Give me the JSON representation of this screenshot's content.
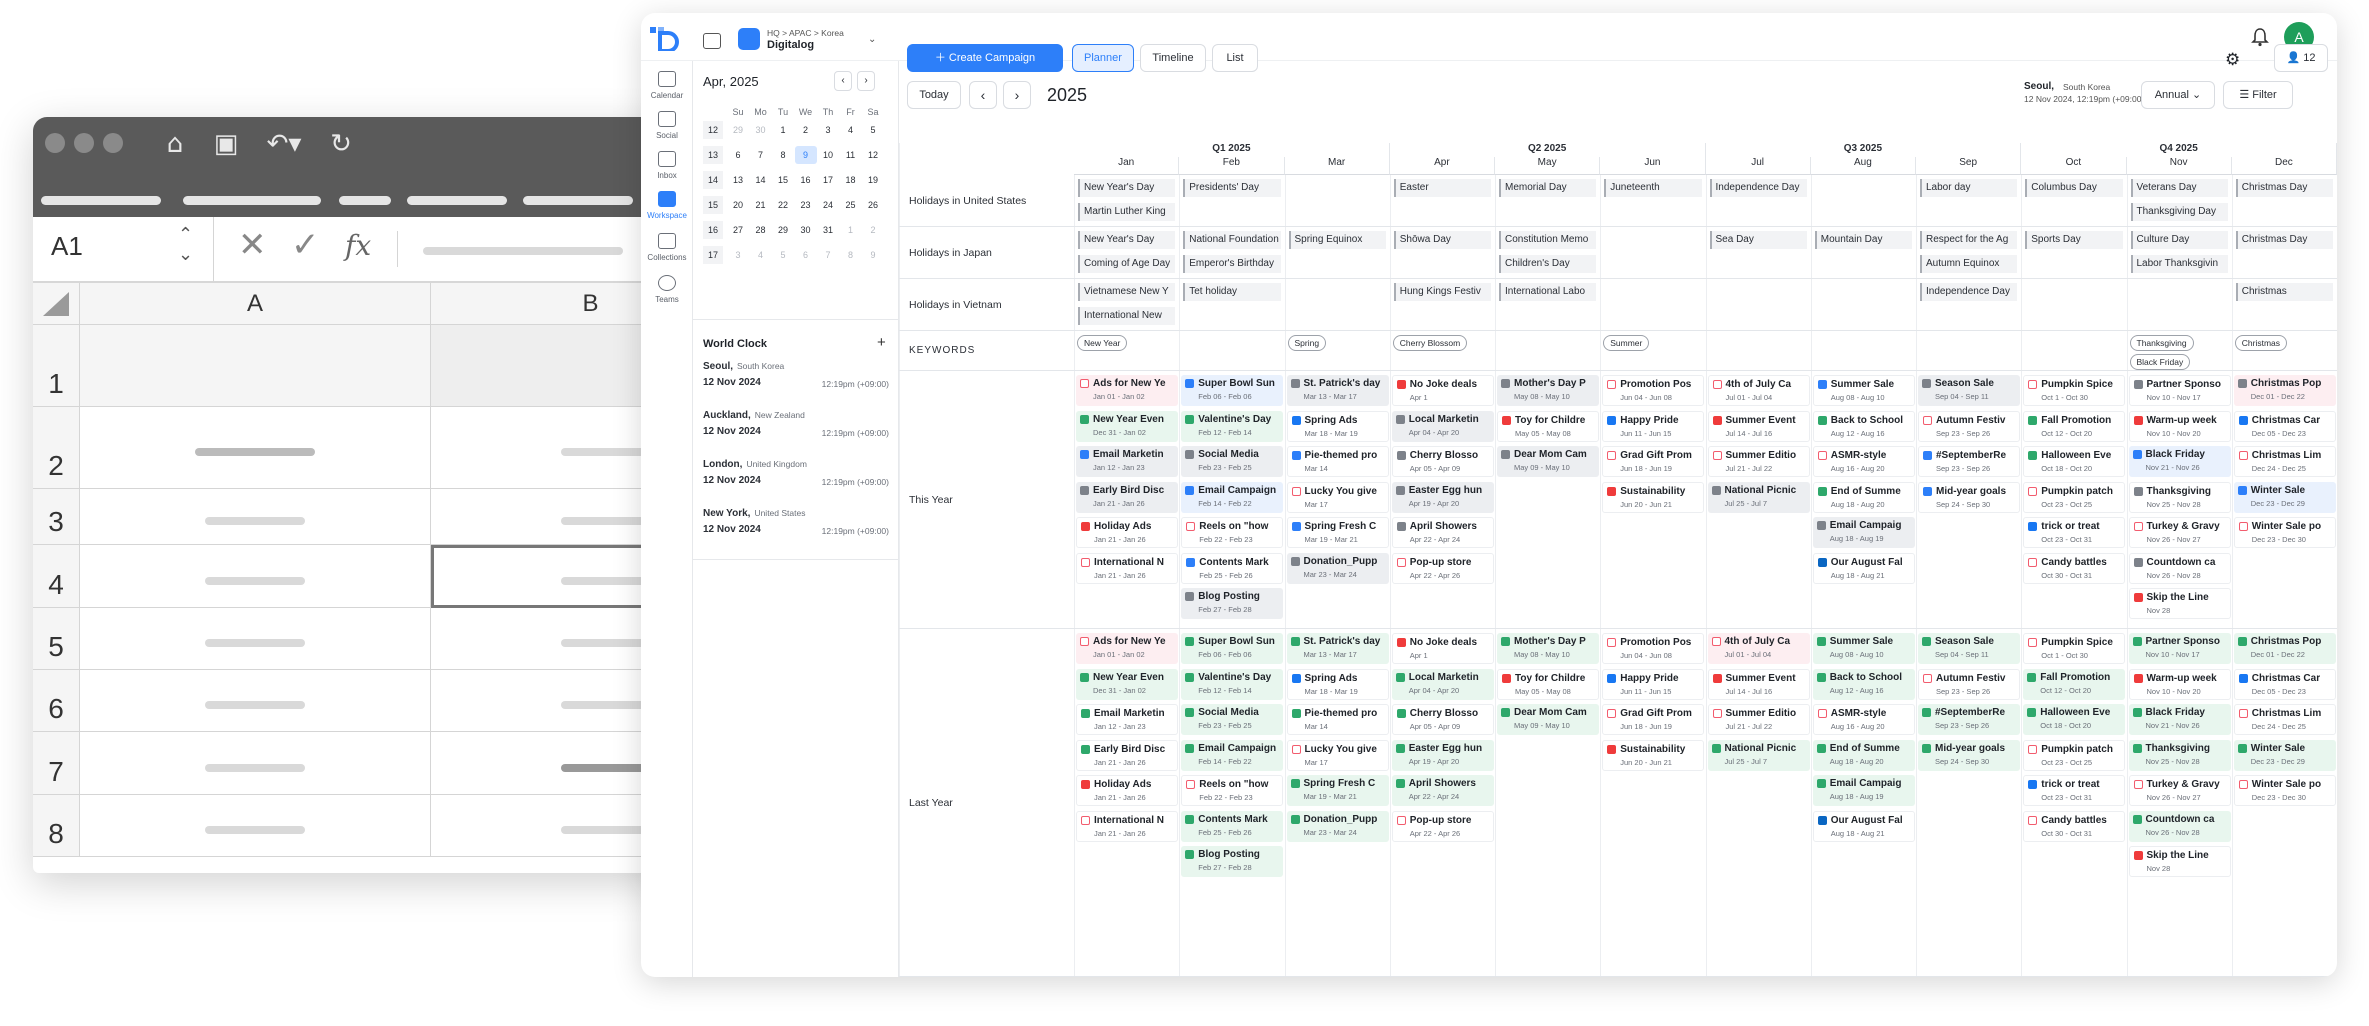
{
  "sheet": {
    "cell_ref": "A1",
    "fx": "fx",
    "col_a": "A",
    "col_b": "B",
    "rows": [
      "1",
      "2",
      "3",
      "4",
      "5",
      "6",
      "7",
      "8"
    ]
  },
  "app": {
    "breadcrumb": "HQ > APAC > Korea",
    "workspace": "Digitalog",
    "create": "Create Campaign",
    "views": [
      "Planner",
      "Timeline",
      "List"
    ],
    "member_count": "12",
    "avatar": "A",
    "nav": [
      "Calendar",
      "Social",
      "Inbox",
      "Workspace",
      "Collections",
      "Teams"
    ],
    "today": "Today",
    "year": "2025",
    "location": "Seoul,",
    "location_country": "South Korea",
    "location_time": "12 Nov 2024, 12:19pm (+09:00)",
    "range": "Annual",
    "filter": "Filter"
  },
  "minical": {
    "title": "Apr, 2025",
    "weekdays": [
      "Su",
      "Mo",
      "Tu",
      "We",
      "Th",
      "Fr",
      "Sa"
    ],
    "weeks": [
      {
        "wk": "12",
        "days": [
          "29",
          "30",
          "1",
          "2",
          "3",
          "4",
          "5"
        ]
      },
      {
        "wk": "13",
        "days": [
          "6",
          "7",
          "8",
          "9",
          "10",
          "11",
          "12"
        ]
      },
      {
        "wk": "14",
        "days": [
          "13",
          "14",
          "15",
          "16",
          "17",
          "18",
          "19"
        ]
      },
      {
        "wk": "15",
        "days": [
          "20",
          "21",
          "22",
          "23",
          "24",
          "25",
          "26"
        ]
      },
      {
        "wk": "16",
        "days": [
          "27",
          "28",
          "29",
          "30",
          "31",
          "1",
          "2"
        ]
      },
      {
        "wk": "17",
        "days": [
          "3",
          "4",
          "5",
          "6",
          "7",
          "8",
          "9"
        ]
      }
    ]
  },
  "world_clock": {
    "title": "World Clock",
    "add": "+",
    "items": [
      {
        "city": "Seoul,",
        "country": "South Korea",
        "date": "12 Nov 2024",
        "time": "12:19pm (+09:00)"
      },
      {
        "city": "Auckland,",
        "country": "New Zealand",
        "date": "12 Nov 2024",
        "time": "12:19pm (+09:00)"
      },
      {
        "city": "London,",
        "country": "United Kingdom",
        "date": "12 Nov 2024",
        "time": "12:19pm (+09:00)"
      },
      {
        "city": "New York,",
        "country": "United States",
        "date": "12 Nov 2024",
        "time": "12:19pm (+09:00)"
      }
    ]
  },
  "timeline": {
    "quarters": [
      "Q1  2025",
      "Q2  2025",
      "Q3  2025",
      "Q4  2025"
    ],
    "months": [
      "Jan",
      "Feb",
      "Mar",
      "Apr",
      "May",
      "Jun",
      "Jul",
      "Aug",
      "Sep",
      "Oct",
      "Nov",
      "Dec"
    ],
    "rows": [
      "Holidays in United States",
      "Holidays in Japan",
      "Holidays in Vietnam",
      "KEYWORDS",
      "This Year",
      "Last Year"
    ],
    "holidays_us": [
      [
        "New Year's Day",
        "Martin Luther King"
      ],
      [
        "Presidents' Day"
      ],
      [],
      [
        "Easter"
      ],
      [
        "Memorial Day"
      ],
      [
        "Juneteenth"
      ],
      [
        "Independence Day"
      ],
      [],
      [
        "Labor day"
      ],
      [
        "Columbus Day"
      ],
      [
        "Veterans Day",
        "Thanksgiving Day"
      ],
      [
        "Christmas Day"
      ]
    ],
    "holidays_jp": [
      [
        "New Year's Day",
        "Coming of Age Day"
      ],
      [
        "National Foundation",
        "Emperor's Birthday"
      ],
      [
        "Spring Equinox"
      ],
      [
        "Shōwa Day"
      ],
      [
        "Constitution Memo",
        "Children's Day"
      ],
      [],
      [
        "Sea Day"
      ],
      [
        "Mountain Day"
      ],
      [
        "Respect for the Ag",
        "Autumn Equinox"
      ],
      [
        "Sports Day"
      ],
      [
        "Culture Day",
        "Labor Thanksgivin"
      ],
      [
        "Christmas Day"
      ]
    ],
    "holidays_vn": [
      [
        "Vietnamese New Y",
        "International New"
      ],
      [
        "Tet holiday"
      ],
      [],
      [
        "Hung Kings Festiv"
      ],
      [
        "International Labo"
      ],
      [],
      [],
      [],
      [
        "Independence Day"
      ],
      [],
      [],
      [
        "Christmas"
      ]
    ],
    "keywords": [
      [
        "New Year"
      ],
      [],
      [
        "Spring"
      ],
      [
        "Cherry Blossom"
      ],
      [],
      [
        "Summer"
      ],
      [],
      [],
      [],
      [],
      [
        "Thanksgiving",
        "Black Friday"
      ],
      [
        "Christmas"
      ]
    ],
    "this_year": [
      [
        [
          "Ads for New Ye",
          "Jan 01 - Jan 02",
          "pink",
          "ig"
        ],
        [
          "New Year Even",
          "Dec 31 - Jan 02",
          "green",
          "green"
        ],
        [
          "Email Marketin",
          "Jan 12 - Jan 23",
          "gray",
          "blue"
        ],
        [
          "Early Bird Disc",
          "Jan 21 - Jan 26",
          "gray",
          "gray"
        ],
        [
          "Holiday Ads",
          "Jan 21 - Jan 26",
          "white",
          "red"
        ],
        [
          "International N",
          "Jan 21 - Jan 26",
          "white",
          "ig"
        ]
      ],
      [
        [
          "Super Bowl Sun",
          "Feb 06 - Feb 06",
          "blue",
          "blue"
        ],
        [
          "Valentine's Day",
          "Feb 12 - Feb 14",
          "green",
          "green"
        ],
        [
          "Social Media",
          "Feb 23 - Feb 25",
          "gray",
          "gray"
        ],
        [
          "Email Campaign",
          "Feb 14 - Feb 22",
          "blue",
          "blue"
        ],
        [
          "Reels on \"how",
          "Feb 22 - Feb 23",
          "white",
          "ig"
        ],
        [
          "Contents Mark",
          "Feb 25 - Feb 26",
          "white",
          "blue"
        ],
        [
          "Blog Posting",
          "Feb 27 - Feb 28",
          "gray",
          "gray"
        ]
      ],
      [
        [
          "St. Patrick's day",
          "Mar 13 - Mar 17",
          "gray",
          "gray"
        ],
        [
          "Spring Ads",
          "Mar 18 - Mar 19",
          "white",
          "fb"
        ],
        [
          "Pie-themed pro",
          "Mar 14",
          "white",
          "blue"
        ],
        [
          "Lucky You give",
          "Mar 17",
          "white",
          "ig"
        ],
        [
          "Spring Fresh C",
          "Mar 19 - Mar 21",
          "white",
          "blue"
        ],
        [
          "Donation_Pupp",
          "Mar 23 - Mar 24",
          "gray",
          "gray"
        ]
      ],
      [
        [
          "No Joke deals",
          "Apr 1",
          "white",
          "red"
        ],
        [
          "Local Marketin",
          "Apr 04 - Apr 20",
          "gray",
          "gray"
        ],
        [
          "Cherry Blosso",
          "Apr 05 - Apr 09",
          "white",
          "gray"
        ],
        [
          "Easter Egg hun",
          "Apr 19 - Apr 20",
          "gray",
          "gray"
        ],
        [
          "April Showers",
          "Apr 22 - Apr 24",
          "white",
          "gray"
        ],
        [
          "Pop-up store",
          "Apr 22 - Apr 26",
          "white",
          "ig"
        ]
      ],
      [
        [
          "Mother's Day P",
          "May 08 - May 10",
          "gray",
          "gray"
        ],
        [
          "Toy for Childre",
          "May 05 - May 08",
          "white",
          "red"
        ],
        [
          "Dear Mom Cam",
          "May 09 - May 10",
          "gray",
          "gray"
        ]
      ],
      [
        [
          "Promotion Pos",
          "Jun 04 - Jun 08",
          "white",
          "ig"
        ],
        [
          "Happy Pride",
          "Jun 11 - Jun 15",
          "white",
          "fb"
        ],
        [
          "Grad Gift Prom",
          "Jun 18 - Jun 19",
          "white",
          "ig"
        ],
        [
          "Sustainability",
          "Jun 20 - Jun 21",
          "white",
          "red"
        ]
      ],
      [
        [
          "4th of July Ca",
          "Jul 01 - Jul 04",
          "white",
          "ig"
        ],
        [
          "Summer Event",
          "Jul 14 - Jul 16",
          "white",
          "red"
        ],
        [
          "Summer Editio",
          "Jul 21 - Jul 22",
          "white",
          "ig"
        ],
        [
          "National Picnic",
          "Jul 25 - Jul 7",
          "gray",
          "gray"
        ]
      ],
      [
        [
          "Summer Sale",
          "Aug 08 - Aug 10",
          "white",
          "blue"
        ],
        [
          "Back to School",
          "Aug 12 - Aug 16",
          "white",
          "green"
        ],
        [
          "ASMR-style",
          "Aug 16 - Aug 20",
          "white",
          "ig"
        ],
        [
          "End of Summe",
          "Aug 18 - Aug 20",
          "white",
          "green"
        ],
        [
          "Email Campaig",
          "Aug 18 - Aug 19",
          "gray",
          "gray"
        ],
        [
          "Our August Fal",
          "Aug 18 - Aug 21",
          "white",
          "li"
        ]
      ],
      [
        [
          "Season Sale",
          "Sep 04 - Sep 11",
          "gray",
          "gray"
        ],
        [
          "Autumn Festiv",
          "Sep 23 - Sep 26",
          "white",
          "ig"
        ],
        [
          "#SeptemberRe",
          "Sep 23 - Sep 26",
          "white",
          "blue"
        ],
        [
          "Mid-year goals",
          "Sep 24 - Sep 30",
          "white",
          "blue"
        ]
      ],
      [
        [
          "Pumpkin Spice",
          "Oct 1 - Oct 30",
          "white",
          "ig"
        ],
        [
          "Fall Promotion",
          "Oct 12 - Oct 20",
          "white",
          "green"
        ],
        [
          "Halloween Eve",
          "Oct 18 - Oct 20",
          "white",
          "green"
        ],
        [
          "Pumpkin patch",
          "Oct 23 - Oct 25",
          "white",
          "ig"
        ],
        [
          "trick or treat",
          "Oct 23 - Oct 31",
          "white",
          "fb"
        ],
        [
          "Candy battles",
          "Oct 30 - Oct 31",
          "white",
          "ig"
        ]
      ],
      [
        [
          "Partner Sponso",
          "Nov 10 - Nov 17",
          "white",
          "gray"
        ],
        [
          "Warm-up week",
          "Nov 10 - Nov 20",
          "white",
          "red"
        ],
        [
          "Black Friday",
          "Nov 21 - Nov 26",
          "blue",
          "blue"
        ],
        [
          "Thanksgiving",
          "Nov 25 - Nov 28",
          "white",
          "gray"
        ],
        [
          "Turkey & Gravy",
          "Nov 26 - Nov 27",
          "white",
          "ig"
        ],
        [
          "Countdown ca",
          "Nov 26 - Nov 28",
          "white",
          "gray"
        ],
        [
          "Skip the Line",
          "Nov 28",
          "white",
          "red"
        ]
      ],
      [
        [
          "Christmas Pop",
          "Dec 01 - Dec 22",
          "pink",
          "gray"
        ],
        [
          "Christmas Car",
          "Dec 05 - Dec 23",
          "white",
          "fb"
        ],
        [
          "Christmas Lim",
          "Dec 24 - Dec 25",
          "white",
          "ig"
        ],
        [
          "Winter Sale",
          "Dec 23 - Dec 29",
          "blue",
          "blue"
        ],
        [
          "Winter Sale po",
          "Dec 23 - Dec 30",
          "white",
          "ig"
        ]
      ]
    ],
    "last_year": [
      [
        [
          "Ads for New Ye",
          "Jan 01 - Jan 02",
          "pink",
          "ig"
        ],
        [
          "New Year Even",
          "Dec 31 - Jan 02",
          "green",
          "green"
        ],
        [
          "Email Marketin",
          "Jan 12 - Jan 23",
          "white",
          "green"
        ],
        [
          "Early Bird Disc",
          "Jan 21 - Jan 26",
          "white",
          "green"
        ],
        [
          "Holiday Ads",
          "Jan 21 - Jan 26",
          "white",
          "red"
        ],
        [
          "International N",
          "Jan 21 - Jan 26",
          "white",
          "ig"
        ]
      ],
      [
        [
          "Super Bowl Sun",
          "Feb 06 - Feb 06",
          "green",
          "green"
        ],
        [
          "Valentine's Day",
          "Feb 12 - Feb 14",
          "green",
          "green"
        ],
        [
          "Social Media",
          "Feb 23 - Feb 25",
          "green",
          "green"
        ],
        [
          "Email Campaign",
          "Feb 14 - Feb 22",
          "green",
          "green"
        ],
        [
          "Reels on \"how",
          "Feb 22 - Feb 23",
          "white",
          "ig"
        ],
        [
          "Contents Mark",
          "Feb 25 - Feb 26",
          "green",
          "green"
        ],
        [
          "Blog Posting",
          "Feb 27 - Feb 28",
          "green",
          "green"
        ]
      ],
      [
        [
          "St. Patrick's day",
          "Mar 13 - Mar 17",
          "green",
          "green"
        ],
        [
          "Spring Ads",
          "Mar 18 - Mar 19",
          "white",
          "fb"
        ],
        [
          "Pie-themed pro",
          "Mar 14",
          "white",
          "green"
        ],
        [
          "Lucky You give",
          "Mar 17",
          "white",
          "ig"
        ],
        [
          "Spring Fresh C",
          "Mar 19 - Mar 21",
          "green",
          "green"
        ],
        [
          "Donation_Pupp",
          "Mar 23 - Mar 24",
          "green",
          "green"
        ]
      ],
      [
        [
          "No Joke deals",
          "Apr 1",
          "white",
          "red"
        ],
        [
          "Local Marketin",
          "Apr 04 - Apr 20",
          "green",
          "green"
        ],
        [
          "Cherry Blosso",
          "Apr 05 - Apr 09",
          "white",
          "green"
        ],
        [
          "Easter Egg hun",
          "Apr 19 - Apr 20",
          "green",
          "green"
        ],
        [
          "April Showers",
          "Apr 22 - Apr 24",
          "green",
          "green"
        ],
        [
          "Pop-up store",
          "Apr 22 - Apr 26",
          "white",
          "ig"
        ]
      ],
      [
        [
          "Mother's Day P",
          "May 08 - May 10",
          "green",
          "green"
        ],
        [
          "Toy for Childre",
          "May 05 - May 08",
          "white",
          "red"
        ],
        [
          "Dear Mom Cam",
          "May 09 - May 10",
          "green",
          "green"
        ]
      ],
      [
        [
          "Promotion Pos",
          "Jun 04 - Jun 08",
          "white",
          "ig"
        ],
        [
          "Happy Pride",
          "Jun 11 - Jun 15",
          "white",
          "fb"
        ],
        [
          "Grad Gift Prom",
          "Jun 18 - Jun 19",
          "white",
          "ig"
        ],
        [
          "Sustainability",
          "Jun 20 - Jun 21",
          "white",
          "red"
        ]
      ],
      [
        [
          "4th of July Ca",
          "Jul 01 - Jul 04",
          "pink",
          "ig"
        ],
        [
          "Summer Event",
          "Jul 14 - Jul 16",
          "white",
          "red"
        ],
        [
          "Summer Editio",
          "Jul 21 - Jul 22",
          "white",
          "ig"
        ],
        [
          "National Picnic",
          "Jul 25 - Jul 7",
          "green",
          "green"
        ]
      ],
      [
        [
          "Summer Sale",
          "Aug 08 - Aug 10",
          "green",
          "green"
        ],
        [
          "Back to School",
          "Aug 12 - Aug 16",
          "green",
          "green"
        ],
        [
          "ASMR-style",
          "Aug 16 - Aug 20",
          "white",
          "ig"
        ],
        [
          "End of Summe",
          "Aug 18 - Aug 20",
          "green",
          "green"
        ],
        [
          "Email Campaig",
          "Aug 18 - Aug 19",
          "green",
          "green"
        ],
        [
          "Our August Fal",
          "Aug 18 - Aug 21",
          "white",
          "li"
        ]
      ],
      [
        [
          "Season Sale",
          "Sep 04 - Sep 11",
          "green",
          "green"
        ],
        [
          "Autumn Festiv",
          "Sep 23 - Sep 26",
          "white",
          "ig"
        ],
        [
          "#SeptemberRe",
          "Sep 23 - Sep 26",
          "green",
          "green"
        ],
        [
          "Mid-year goals",
          "Sep 24 - Sep 30",
          "green",
          "green"
        ]
      ],
      [
        [
          "Pumpkin Spice",
          "Oct 1 - Oct 30",
          "white",
          "ig"
        ],
        [
          "Fall Promotion",
          "Oct 12 - Oct 20",
          "green",
          "green"
        ],
        [
          "Halloween Eve",
          "Oct 18 - Oct 20",
          "green",
          "green"
        ],
        [
          "Pumpkin patch",
          "Oct 23 - Oct 25",
          "white",
          "ig"
        ],
        [
          "trick or treat",
          "Oct 23 - Oct 31",
          "white",
          "fb"
        ],
        [
          "Candy battles",
          "Oct 30 - Oct 31",
          "white",
          "ig"
        ]
      ],
      [
        [
          "Partner Sponso",
          "Nov 10 - Nov 17",
          "green",
          "green"
        ],
        [
          "Warm-up week",
          "Nov 10 - Nov 20",
          "white",
          "red"
        ],
        [
          "Black Friday",
          "Nov 21 - Nov 26",
          "green",
          "green"
        ],
        [
          "Thanksgiving",
          "Nov 25 - Nov 28",
          "green",
          "green"
        ],
        [
          "Turkey & Gravy",
          "Nov 26 - Nov 27",
          "white",
          "ig"
        ],
        [
          "Countdown ca",
          "Nov 26 - Nov 28",
          "green",
          "green"
        ],
        [
          "Skip the Line",
          "Nov 28",
          "white",
          "red"
        ]
      ],
      [
        [
          "Christmas Pop",
          "Dec 01 - Dec 22",
          "green",
          "green"
        ],
        [
          "Christmas Car",
          "Dec 05 - Dec 23",
          "white",
          "fb"
        ],
        [
          "Christmas Lim",
          "Dec 24 - Dec 25",
          "white",
          "ig"
        ],
        [
          "Winter Sale",
          "Dec 23 - Dec 29",
          "green",
          "green"
        ],
        [
          "Winter Sale po",
          "Dec 23 - Dec 30",
          "white",
          "ig"
        ]
      ]
    ]
  },
  "colors": {
    "accent": "#2d7ff9",
    "green": "#2ea86b",
    "red": "#ef3b3b"
  }
}
